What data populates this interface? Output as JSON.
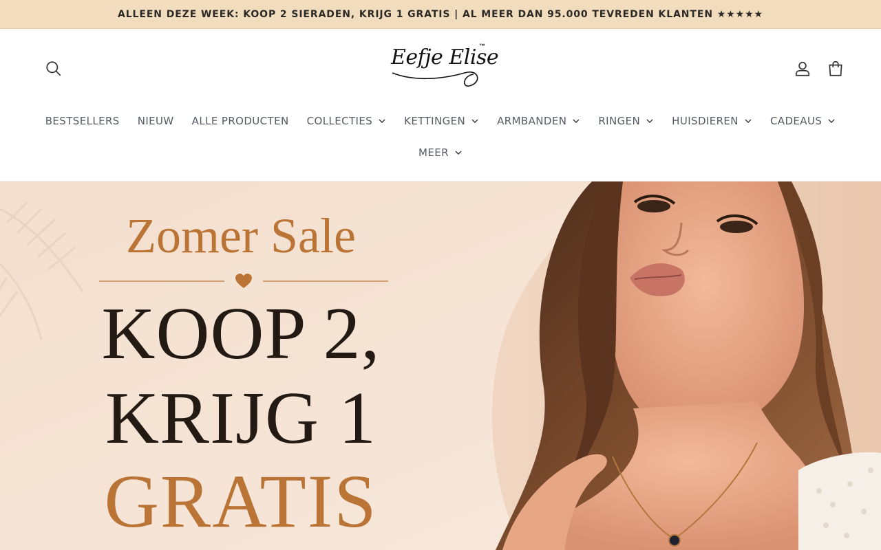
{
  "announcement": {
    "text": "ALLEEN DEZE WEEK: KOOP 2 SIERADEN, KRIJG 1 GRATIS | AL MEER DAN 95.000 TEVREDEN KLANTEN ★★★★★"
  },
  "header": {
    "logo": {
      "text": "Eefje Elise",
      "tm": "™"
    },
    "icons": {
      "search": "search-icon",
      "account": "account-icon",
      "cart": "cart-icon"
    }
  },
  "nav": {
    "row1": [
      {
        "label": "BESTSELLERS",
        "dropdown": false
      },
      {
        "label": "NIEUW",
        "dropdown": false
      },
      {
        "label": "ALLE PRODUCTEN",
        "dropdown": false
      },
      {
        "label": "COLLECTIES",
        "dropdown": true
      },
      {
        "label": "KETTINGEN",
        "dropdown": true
      },
      {
        "label": "ARMBANDEN",
        "dropdown": true
      },
      {
        "label": "RINGEN",
        "dropdown": true
      },
      {
        "label": "HUISDIEREN",
        "dropdown": true
      },
      {
        "label": "CADEAUS",
        "dropdown": true
      }
    ],
    "row2": [
      {
        "label": "MEER",
        "dropdown": true
      }
    ]
  },
  "hero": {
    "headline": "Zomer Sale",
    "line1": "KOOP 2,",
    "line2": "KRIJG 1",
    "line3": "GRATIS",
    "colors": {
      "accent": "#b97436",
      "dark": "#231a14",
      "background": "#f7e6d8"
    }
  },
  "colors": {
    "announcement_bg": "#f1dcbd",
    "nav_text": "#555a63"
  }
}
